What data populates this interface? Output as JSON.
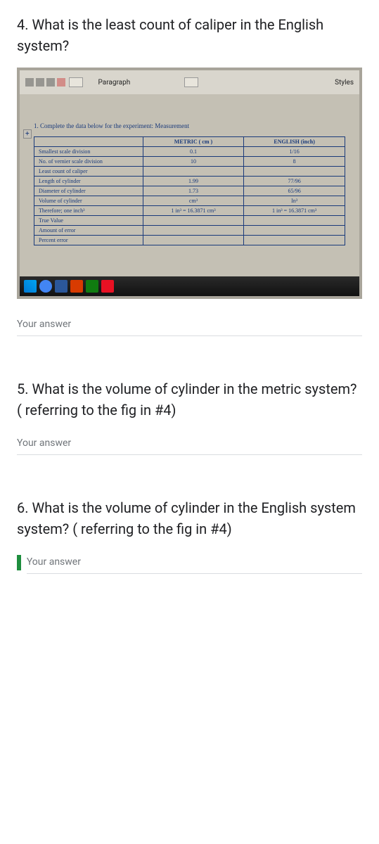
{
  "q4": {
    "title": "4. What is the least count of caliper in the English system?",
    "answer_placeholder": "Your answer"
  },
  "q5": {
    "title": "5. What is the volume of cylinder in the metric system? ( referring to the fig in #4)",
    "answer_placeholder": "Your answer"
  },
  "q6": {
    "title": "6. What is the volume of cylinder in the English system system? ( referring to the fig in #4)",
    "answer_placeholder": "Your answer"
  },
  "embedded_doc": {
    "toolbar_label": "Paragraph",
    "toolbar_styles": "Styles",
    "instruction": "1. Complete the data below for the experiment: Measurement",
    "marker": "+",
    "table": {
      "headers": [
        "",
        "METRIC ( cm )",
        "ENGLISH (inch)"
      ],
      "rows": [
        [
          "Smallest scale division",
          "0.1",
          "1/16"
        ],
        [
          "No. of vernier scale division",
          "10",
          "8"
        ],
        [
          "Least count of caliper",
          "",
          ""
        ],
        [
          "Length of cylinder",
          "1.99",
          "77/96"
        ],
        [
          "Diameter of cylinder",
          "1.73",
          "65/96"
        ],
        [
          "Volume of cylinder",
          "cm³",
          "In³"
        ],
        [
          "Therefore; one inch³",
          "1 in³ = 16.3871 cm³",
          "1 in³ = 16.3871 cm³"
        ],
        [
          "True Value",
          "",
          ""
        ],
        [
          "Amount of error",
          "",
          ""
        ],
        [
          "Percent error",
          "",
          ""
        ]
      ]
    }
  }
}
